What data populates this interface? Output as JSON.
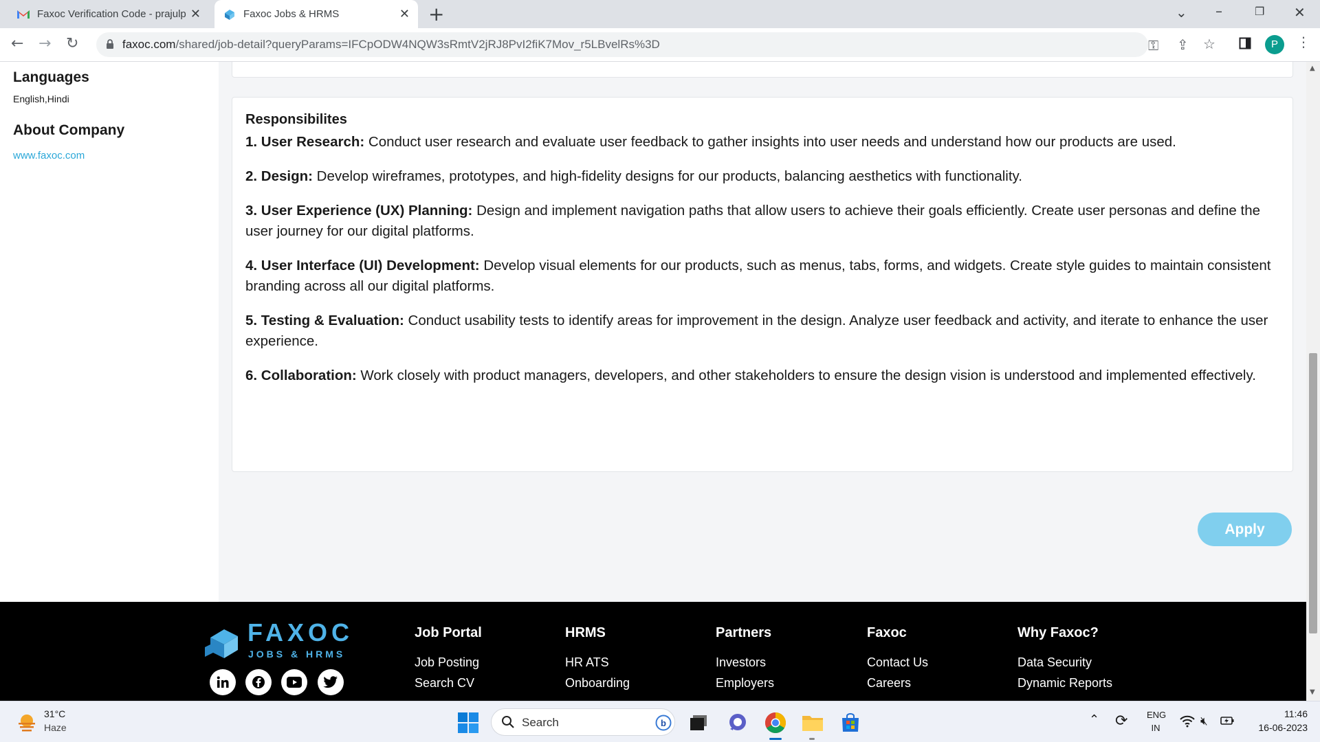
{
  "browser": {
    "tabs": [
      {
        "title": "Faxoc Verification Code - prajulp"
      },
      {
        "title": "Faxoc Jobs & HRMS"
      }
    ],
    "url_host": "faxoc.com",
    "url_path": "/shared/job-detail?queryParams=IFCpODW4NQW3sRmtV2jRJ8PvI2fiK7Mov_r5LBvelRs%3D",
    "profile_initial": "P"
  },
  "sidebar": {
    "languages_heading": "Languages",
    "languages_value": "English,Hindi",
    "about_heading": "About Company",
    "website": "www.faxoc.com"
  },
  "responsibilities": {
    "title": "Responsibilites",
    "items": [
      {
        "label": "1. User Research:",
        "text": " Conduct user research and evaluate user feedback to gather insights into user needs and understand how our products are used."
      },
      {
        "label": "2. Design:",
        "text": " Develop wireframes, prototypes, and high-fidelity designs for our products, balancing aesthetics with functionality."
      },
      {
        "label": "3. User Experience (UX) Planning:",
        "text": " Design and implement navigation paths that allow users to achieve their goals efficiently. Create user personas and define the user journey for our digital platforms."
      },
      {
        "label": "4. User Interface (UI) Development:",
        "text": " Develop visual elements for our products, such as menus, tabs, forms, and widgets. Create style guides to maintain consistent branding across all our digital platforms."
      },
      {
        "label": "5. Testing & Evaluation:",
        "text": " Conduct usability tests to identify areas for improvement in the design. Analyze user feedback and activity, and iterate to enhance the user experience."
      },
      {
        "label": "6. Collaboration:",
        "text": " Work closely with product managers, developers, and other stakeholders to ensure the design vision is understood and implemented effectively."
      }
    ]
  },
  "apply_label": "Apply",
  "footer": {
    "brand": "FAXOC",
    "tagline": "JOBS & HRMS",
    "columns": [
      {
        "heading": "Job Portal",
        "items": [
          "Job Posting",
          "Search CV"
        ]
      },
      {
        "heading": "HRMS",
        "items": [
          "HR ATS",
          "Onboarding"
        ]
      },
      {
        "heading": "Partners",
        "items": [
          "Investors",
          "Employers"
        ]
      },
      {
        "heading": "Faxoc",
        "items": [
          "Contact Us",
          "Careers"
        ]
      },
      {
        "heading": "Why Faxoc?",
        "items": [
          "Data Security",
          "Dynamic Reports"
        ]
      }
    ]
  },
  "taskbar": {
    "temperature": "31°C",
    "weather": "Haze",
    "search_placeholder": "Search",
    "lang1": "ENG",
    "lang2": "IN",
    "time": "11:46",
    "date": "16-06-2023"
  },
  "colors": {
    "accent": "#2aa7d8",
    "apply_bg": "#80cfee",
    "footer_bg": "#000000",
    "brand": "#4fb3e8"
  }
}
